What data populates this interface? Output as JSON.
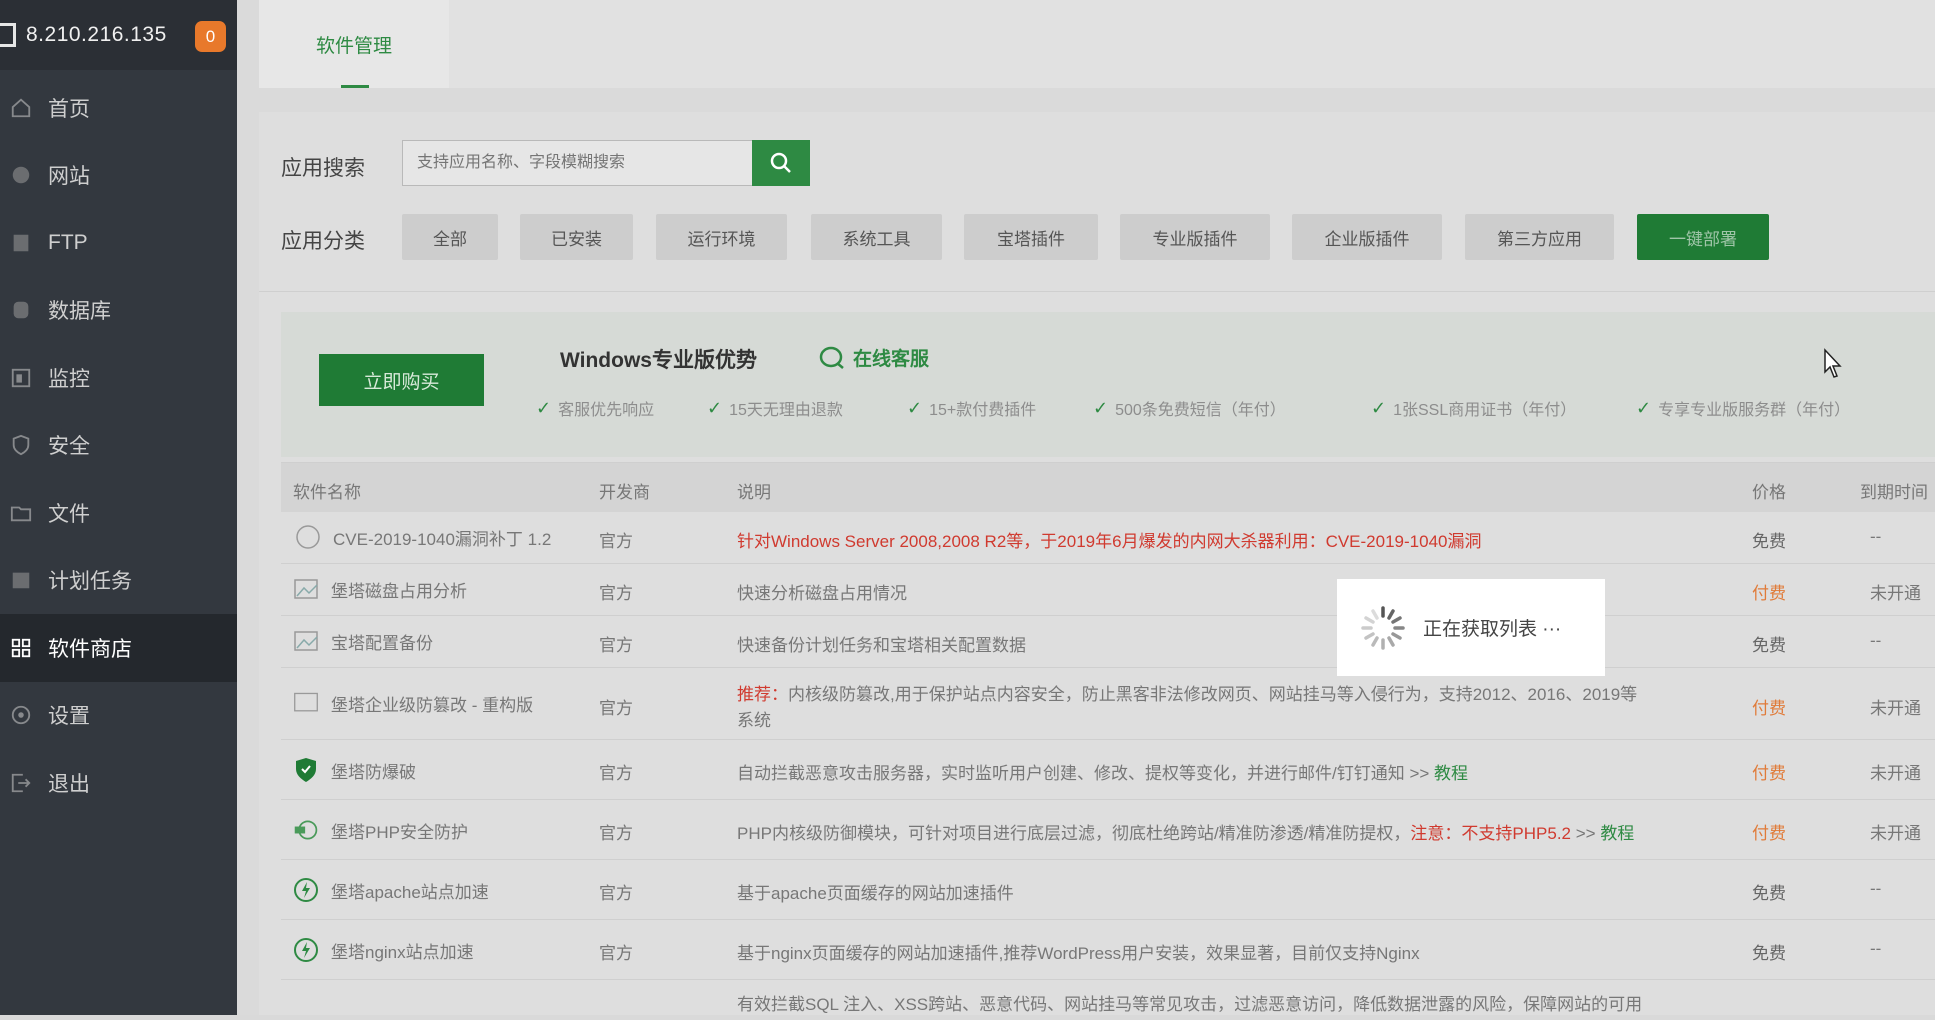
{
  "server": {
    "ip": "8.210.216.135",
    "badge": "0"
  },
  "nav": {
    "items": [
      {
        "label": "首页",
        "icon": "home-icon"
      },
      {
        "label": "网站",
        "icon": "globe-icon"
      },
      {
        "label": "FTP",
        "icon": "ftp-icon"
      },
      {
        "label": "数据库",
        "icon": "database-icon"
      },
      {
        "label": "监控",
        "icon": "monitor-icon"
      },
      {
        "label": "安全",
        "icon": "shield-icon"
      },
      {
        "label": "文件",
        "icon": "folder-icon"
      },
      {
        "label": "计划任务",
        "icon": "calendar-icon"
      },
      {
        "label": "软件商店",
        "icon": "apps-grid-icon",
        "active": true
      },
      {
        "label": "设置",
        "icon": "gear-icon"
      },
      {
        "label": "退出",
        "icon": "logout-icon"
      }
    ]
  },
  "tabs": {
    "active": "软件管理"
  },
  "search": {
    "label": "应用搜索",
    "placeholder": "支持应用名称、字段模糊搜索"
  },
  "categories": {
    "label": "应用分类",
    "items": [
      "全部",
      "已安装",
      "运行环境",
      "系统工具",
      "宝塔插件",
      "专业版插件",
      "企业版插件",
      "第三方应用",
      "一键部署"
    ]
  },
  "promo": {
    "buy": "立即购买",
    "title": "Windows专业版优势",
    "online": "在线客服",
    "features": [
      "客服优先响应",
      "15天无理由退款",
      "15+款付费插件",
      "500条免费短信（年付）",
      "1张SSL商用证书（年付）",
      "专享专业版服务群（年付）"
    ]
  },
  "table": {
    "headers": {
      "name": "软件名称",
      "dev": "开发商",
      "desc": "说明",
      "price": "价格",
      "expire": "到期时间"
    },
    "rows": [
      {
        "name": "CVE-2019-1040漏洞补丁 1.2",
        "dev": "官方",
        "desc": "针对Windows Server 2008,2008 R2等，于2019年6月爆发的内网大杀器利用：CVE-2019-1040漏洞",
        "price": "免费",
        "expire": "--"
      },
      {
        "name": "堡塔磁盘占用分析",
        "dev": "官方",
        "desc": "快速分析磁盘占用情况",
        "price": "付费",
        "expire": "未开通"
      },
      {
        "name": "宝塔配置备份",
        "dev": "官方",
        "desc": "快速备份计划任务和宝塔相关配置数据",
        "price": "免费",
        "expire": "--"
      },
      {
        "name": "堡塔企业级防篡改 - 重构版",
        "dev": "官方",
        "desc_prefix": "推荐：",
        "desc": "内核级防篡改,用于保护站点内容安全，防止黑客非法修改网页、网站挂马等入侵行为，支持2012、2016、2019等",
        "desc2": "系统",
        "price": "付费",
        "expire": "未开通"
      },
      {
        "name": "堡塔防爆破",
        "dev": "官方",
        "desc": "自动拦截恶意攻击服务器，实时监听用户创建、修改、提权等变化，并进行邮件/钉钉通知 >> ",
        "desc_link": "教程",
        "price": "付费",
        "expire": "未开通"
      },
      {
        "name": "堡塔PHP安全防护",
        "dev": "官方",
        "desc": "PHP内核级防御模块，可针对项目进行底层过滤，彻底杜绝跨站/精准防渗透/精准防提权，",
        "desc_warn": "注意：不支持PHP5.2",
        "desc_tail": " >> ",
        "desc_link": "教程",
        "price": "付费",
        "expire": "未开通"
      },
      {
        "name": "堡塔apache站点加速",
        "dev": "官方",
        "desc": "基于apache页面缓存的网站加速插件",
        "price": "免费",
        "expire": "--"
      },
      {
        "name": "堡塔nginx站点加速",
        "dev": "官方",
        "desc": "基于nginx页面缓存的网站加速插件,推荐WordPress用户安装，效果显著，目前仅支持Nginx",
        "price": "免费",
        "expire": "--"
      },
      {
        "name": "",
        "dev": "",
        "desc": "有效拦截SQL 注入、XSS跨站、恶意代码、网站挂马等常见攻击，过滤恶意访问，降低数据泄露的风险，保障网站的可用",
        "price": "",
        "expire": ""
      }
    ]
  },
  "loading": {
    "text": "正在获取列表 ···"
  },
  "colors": {
    "accent": "#2e8a43",
    "sidebar": "#33383f",
    "badge": "#e8792b",
    "danger": "#d03a2f",
    "paid": "#e07b39"
  }
}
